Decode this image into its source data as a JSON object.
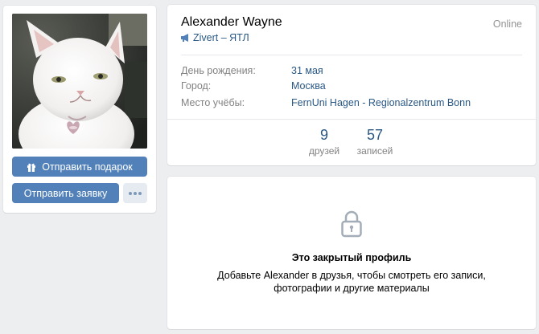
{
  "profile": {
    "name": "Alexander Wayne",
    "online": "Online",
    "status": "Zivert – ЯТЛ"
  },
  "info": {
    "rows": [
      {
        "label": "День рождения:",
        "value": "31 мая"
      },
      {
        "label": "Город:",
        "value": "Москва"
      },
      {
        "label": "Место учёбы:",
        "value": "FernUni Hagen - Regionalzentrum Bonn"
      }
    ]
  },
  "counters": [
    {
      "num": "9",
      "label": "друзей"
    },
    {
      "num": "57",
      "label": "записей"
    }
  ],
  "buttons": {
    "gift": "Отправить подарок",
    "request": "Отправить заявку"
  },
  "closed": {
    "title": "Это закрытый профиль",
    "line1": "Добавьте Alexander в друзья, чтобы смотреть его записи,",
    "line2": "фотографии и другие материалы"
  },
  "icons": {
    "status": "megaphone-icon",
    "gift": "gift-icon",
    "more": "more-dots-icon",
    "lock": "lock-icon"
  },
  "colors": {
    "accent": "#5181b8",
    "link": "#2a5885",
    "muted": "#828282",
    "background": "#edeef0"
  }
}
